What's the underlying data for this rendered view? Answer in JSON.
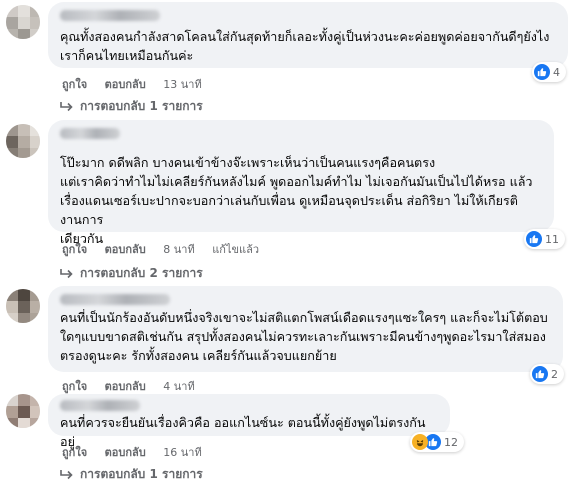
{
  "comments": [
    {
      "text": "คุณทั้งสองคนกำลังสาดโคลนใส่กันสุดท้ายก็เลอะทั้งคู่เป็นห่วงนะคะค่อยพูดค่อยจากันดีๆยังไง\nเราก็คนไทยเหมือนกันค่ะ",
      "like_label": "ถูกใจ",
      "reply_label": "ตอบกลับ",
      "time": "13 นาที",
      "edited": "",
      "reaction_count": "4",
      "reactions": [
        "like-icon"
      ],
      "replies_label": "การตอบกลับ 1 รายการ"
    },
    {
      "text": "โป๊ะมาก ดดีพลิก บางคนเข้าข้างจ๊ะเพราะเห็นว่าเป็นคนแรงๆคือคนตรง\nแต่เราคิดว่าทำไมไม่เคลียร์กันหลังไมค์ พูดออกไมค์ทำไม ไม่เจอกันมันเป็นไปได้หรอ แล้ว\nเรื่องแดนเซอร์เบะปากจะบอกว่าเล่นกับเพื่อน ดูเหมือนจุดประเด็น ส่อกิริยา ไม่ให้เกียรติงานการ\nเดียวกัน",
      "like_label": "ถูกใจ",
      "reply_label": "ตอบกลับ",
      "time": "8 นาที",
      "edited": "แก้ไขแล้ว",
      "reaction_count": "11",
      "reactions": [
        "like-icon"
      ],
      "replies_label": "การตอบกลับ 2 รายการ"
    },
    {
      "text": "คนที่เป็นนักร้องอันดับหนึ่งจริงเขาจะไม่สติแตกโพสน์เดือดแรงๆแซะใครๆ และก็จะไม่โต้ตอบ\nใดๆแบบขาดสติเช่นกัน สรุปทั้งสองคนไม่ควรทะเลาะกันเพราะมีคนข้างๆพูดอะไรมาใส่สมอง\nตรองดูนะคะ รักทั้งสองคน เคลียร์กันแล้วจบแยกย้าย",
      "like_label": "ถูกใจ",
      "reply_label": "ตอบกลับ",
      "time": "4 นาที",
      "edited": "",
      "reaction_count": "2",
      "reactions": [
        "like-icon"
      ],
      "replies_label": ""
    },
    {
      "text": "คนที่ควรจะยืนยันเรื่องคิวคือ ออแกไนซ์นะ ตอนนี้ทั้งคู่ยังพูดไม่ตรงกันอยู่",
      "like_label": "ถูกใจ",
      "reply_label": "ตอบกลับ",
      "time": "16 นาที",
      "edited": "",
      "reaction_count": "12",
      "reactions": [
        "haha-icon",
        "like-icon"
      ],
      "replies_label": "การตอบกลับ 1 รายการ"
    }
  ],
  "colors": {
    "bubble": "#f0f2f5",
    "meta_text": "#65676b",
    "like_blue": "#1877f2",
    "haha_yellow": "#f7b125"
  }
}
